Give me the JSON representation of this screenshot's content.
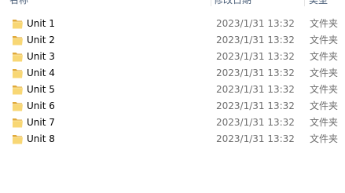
{
  "header": {
    "name": "名称",
    "date_modified": "修改日期",
    "type": "类型"
  },
  "items": [
    {
      "name": "Unit 1",
      "date": "2023/1/31 13:32",
      "type": "文件夹",
      "icon": "folder-icon"
    },
    {
      "name": "Unit 2",
      "date": "2023/1/31 13:32",
      "type": "文件夹",
      "icon": "folder-icon"
    },
    {
      "name": "Unit 3",
      "date": "2023/1/31 13:32",
      "type": "文件夹",
      "icon": "folder-icon"
    },
    {
      "name": "Unit 4",
      "date": "2023/1/31 13:32",
      "type": "文件夹",
      "icon": "folder-icon"
    },
    {
      "name": "Unit 5",
      "date": "2023/1/31 13:32",
      "type": "文件夹",
      "icon": "folder-icon"
    },
    {
      "name": "Unit 6",
      "date": "2023/1/31 13:32",
      "type": "文件夹",
      "icon": "folder-icon"
    },
    {
      "name": "Unit 7",
      "date": "2023/1/31 13:32",
      "type": "文件夹",
      "icon": "folder-icon"
    },
    {
      "name": "Unit 8",
      "date": "2023/1/31 13:32",
      "type": "文件夹",
      "icon": "folder-icon"
    }
  ],
  "colors": {
    "folder_light": "#f8d775",
    "folder_dark": "#e0a93a",
    "header_text": "#4c607a",
    "detail_text": "#6d6d6d"
  }
}
